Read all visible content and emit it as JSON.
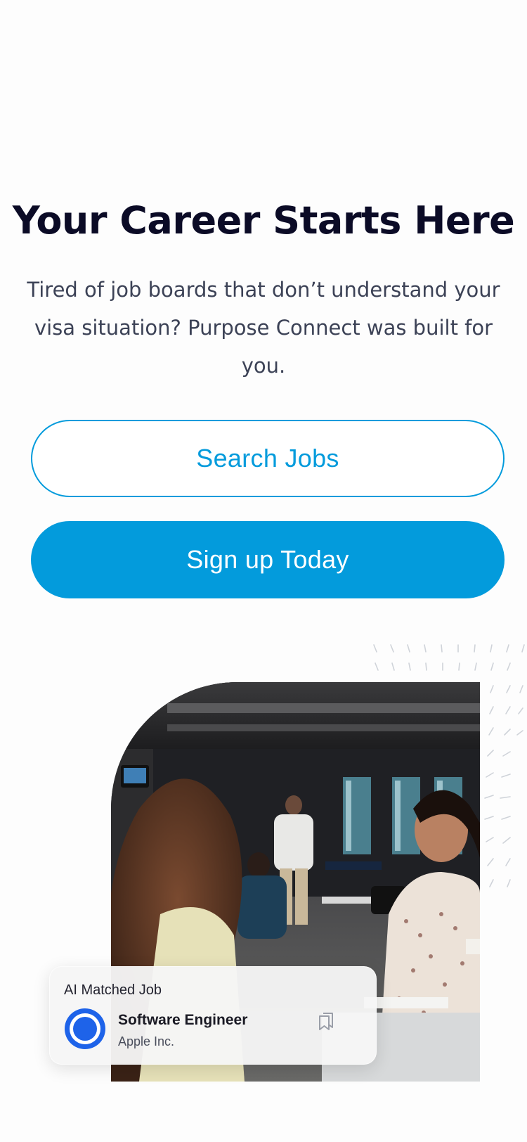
{
  "hero": {
    "title": "Your Career Starts Here",
    "subtitle": "Tired of job boards that don’t understand your visa situation? Purpose Connect was built for you."
  },
  "buttons": {
    "search_jobs": "Search Jobs",
    "sign_up": "Sign up Today"
  },
  "job_card": {
    "label": "AI Matched Job",
    "job_title": "Software Engineer",
    "company": "Apple Inc.",
    "bookmark_icon": "bookmark-icon",
    "logo_icon": "company-logo-icon"
  },
  "colors": {
    "accent": "#039BDC",
    "title": "#0B0B26",
    "body_text": "#3C4256",
    "logo_blue": "#1E63E9"
  }
}
